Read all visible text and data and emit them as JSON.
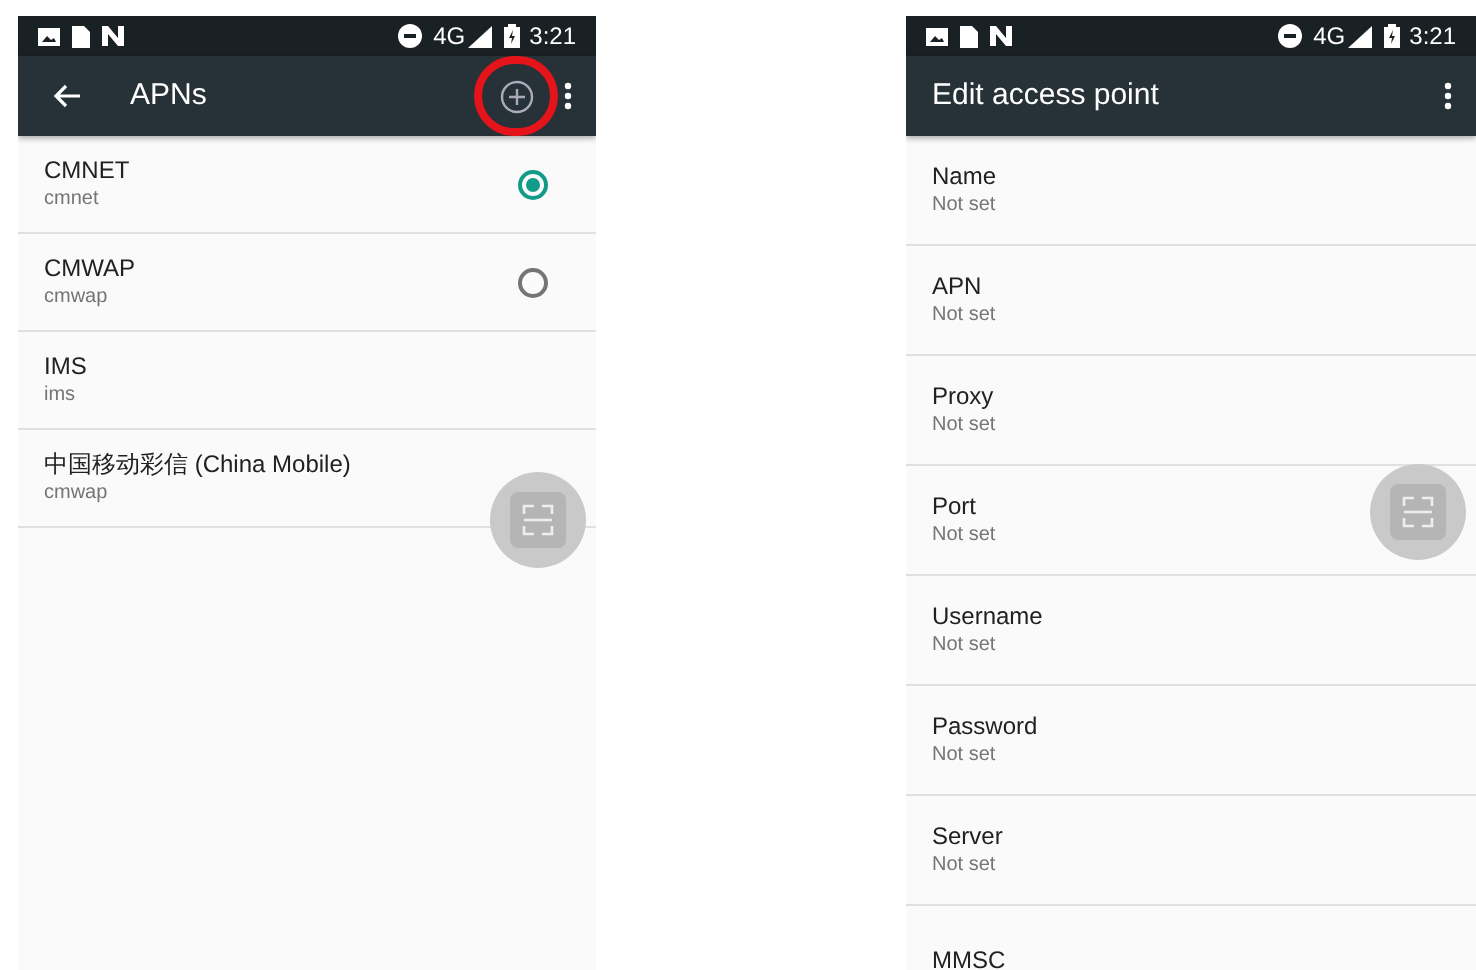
{
  "screens": [
    {
      "kind": "apn_list",
      "status_bar": {
        "network": "4G",
        "time": "3:21"
      },
      "toolbar": {
        "title": "APNs",
        "add_highlighted": true
      },
      "apns": [
        {
          "name": "CMNET",
          "apn": "cmnet",
          "selected": true
        },
        {
          "name": "CMWAP",
          "apn": "cmwap",
          "selected": false
        },
        {
          "name": "IMS",
          "apn": "ims"
        },
        {
          "name": "中国移动彩信 (China Mobile)",
          "apn": "cmwap"
        }
      ]
    },
    {
      "kind": "edit",
      "status_bar": {
        "network": "4G",
        "time": "3:21"
      },
      "toolbar": {
        "title": "Edit access point"
      },
      "fields": [
        {
          "label": "Name",
          "value": "Not set"
        },
        {
          "label": "APN",
          "value": "Not set"
        },
        {
          "label": "Proxy",
          "value": "Not set"
        },
        {
          "label": "Port",
          "value": "Not set"
        },
        {
          "label": "Username",
          "value": "Not set"
        },
        {
          "label": "Password",
          "value": "Not set"
        },
        {
          "label": "Server",
          "value": "Not set"
        },
        {
          "label": "MMSC"
        }
      ]
    }
  ]
}
